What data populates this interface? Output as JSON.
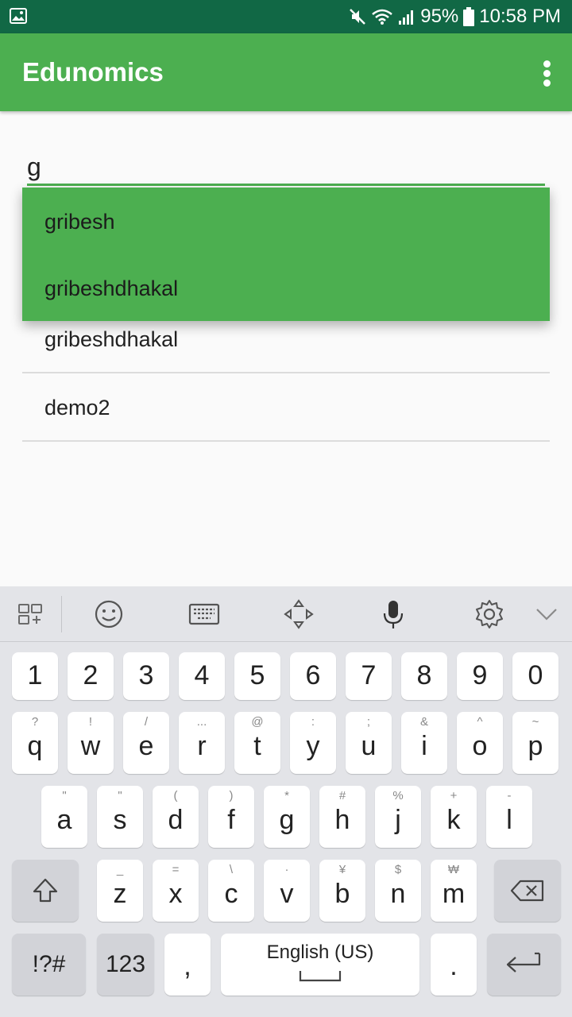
{
  "status_bar": {
    "battery": "95%",
    "time": "10:58 PM"
  },
  "app_bar": {
    "title": "Edunomics"
  },
  "search": {
    "value": "g"
  },
  "dropdown": {
    "options": [
      "gribesh",
      "gribeshdhakal"
    ]
  },
  "list": {
    "items": [
      "gribeshdhakal",
      "demo2"
    ]
  },
  "keyboard": {
    "toolbar_icons": [
      "apps-icon",
      "emoji-icon",
      "keyboard-icon",
      "cursor-move-icon",
      "mic-icon",
      "settings-icon",
      "chevron-down-icon"
    ],
    "numbers": [
      "1",
      "2",
      "3",
      "4",
      "5",
      "6",
      "7",
      "8",
      "9",
      "0"
    ],
    "row1": [
      {
        "key": "q",
        "sub": "?"
      },
      {
        "key": "w",
        "sub": "!"
      },
      {
        "key": "e",
        "sub": "/"
      },
      {
        "key": "r",
        "sub": "..."
      },
      {
        "key": "t",
        "sub": "@"
      },
      {
        "key": "y",
        "sub": ":"
      },
      {
        "key": "u",
        "sub": ";"
      },
      {
        "key": "i",
        "sub": "&"
      },
      {
        "key": "o",
        "sub": "^"
      },
      {
        "key": "p",
        "sub": "~"
      }
    ],
    "row2": [
      {
        "key": "a",
        "sub": "\""
      },
      {
        "key": "s",
        "sub": "\""
      },
      {
        "key": "d",
        "sub": "("
      },
      {
        "key": "f",
        "sub": ")"
      },
      {
        "key": "g",
        "sub": "*"
      },
      {
        "key": "h",
        "sub": "#"
      },
      {
        "key": "j",
        "sub": "%"
      },
      {
        "key": "k",
        "sub": "+"
      },
      {
        "key": "l",
        "sub": "-"
      }
    ],
    "row3": [
      {
        "key": "z",
        "sub": "_"
      },
      {
        "key": "x",
        "sub": "="
      },
      {
        "key": "c",
        "sub": "\\"
      },
      {
        "key": "v",
        "sub": "·"
      },
      {
        "key": "b",
        "sub": "¥"
      },
      {
        "key": "n",
        "sub": "$"
      },
      {
        "key": "m",
        "sub": "₩"
      }
    ],
    "symbols_key": "!?#",
    "numbers_key": "123",
    "comma_key": ",",
    "space_label": "English (US)",
    "period_key": "."
  }
}
